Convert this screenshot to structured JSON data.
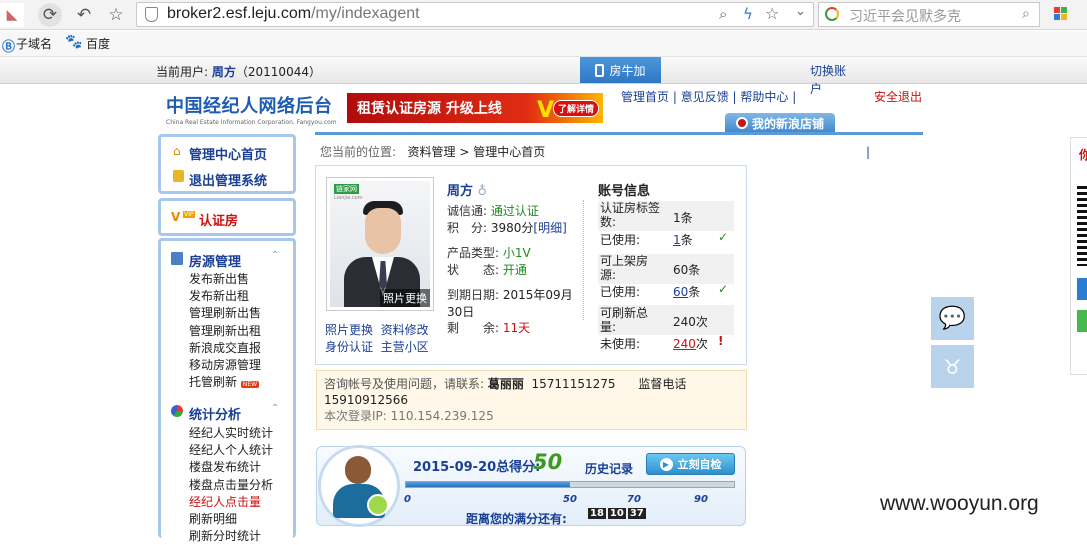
{
  "browser": {
    "url_host": "broker2.esf.leju.com",
    "url_path": "/my/indexagent",
    "search_placeholder": "习近平会见默多克",
    "bookmarks": [
      {
        "label": "子域名"
      },
      {
        "label": "百度"
      }
    ]
  },
  "topbar": {
    "current_user_label": "当前用户:",
    "user_name": "周方",
    "user_id": "（20110044）",
    "fangniu_button": "房牛加",
    "switch_account": "切换账户"
  },
  "header": {
    "logo_cn": "中国经纪人网络后台",
    "logo_en": "China Real Estate Information Corporation. Fangyou.com",
    "banner_text": "租赁认证房源 升级上线",
    "banner_link": "了解详情",
    "nav": [
      {
        "label": "管理首页"
      },
      {
        "label": "意见反馈"
      },
      {
        "label": "帮助中心"
      }
    ],
    "logout": "安全退出",
    "my_shop": "我的新浪店铺"
  },
  "sidebar": {
    "home": "管理中心首页",
    "exit": "退出管理系统",
    "vip": "认证房",
    "housing": {
      "title": "房源管理",
      "items": [
        "发布新出售",
        "发布新出租",
        "管理刷新出售",
        "管理刷新出租",
        "新浪成交直报",
        "移动房源管理",
        "托管刷新"
      ]
    },
    "stats": {
      "title": "统计分析",
      "items": [
        "经纪人实时统计",
        "经纪人个人统计",
        "楼盘发布统计",
        "楼盘点击量分析",
        "经纪人点击量",
        "刷新明细",
        "刷新分时统计"
      ]
    },
    "new_badge": "NEW"
  },
  "breadcrumb": {
    "prefix": "您当前的位置:",
    "section": "资料管理",
    "separator": ">",
    "page": "管理中心首页"
  },
  "profile": {
    "photo_change": "照片更换",
    "photo_watermark": "链家网",
    "photo_watermark_sub": "Lianjia.com",
    "links": [
      "照片更换",
      "资料修改",
      "身份认证",
      "主营小区"
    ],
    "name": "周方",
    "rows": [
      {
        "label": "诚信通:",
        "value": "通过认证"
      },
      {
        "label": "积　分:",
        "value": "3980分",
        "extra": "[明细]"
      },
      {
        "label": "产品类型:",
        "value": "小1V"
      },
      {
        "label": "状　　态:",
        "value": "开通"
      },
      {
        "label": "到期日期:",
        "value": "2015年09月30日"
      },
      {
        "label": "剩　　余:",
        "value": "11天"
      }
    ]
  },
  "account": {
    "title": "账号信息",
    "items": [
      {
        "label": "认证房标签数:",
        "value": "1条"
      },
      {
        "label": "已使用:",
        "value": "1",
        "unit": "条",
        "mark": "✓"
      },
      {
        "label": "可上架房源:",
        "value": "60条"
      },
      {
        "label": "已使用:",
        "value": "60",
        "unit": "条",
        "mark": "✓"
      },
      {
        "label": "可刷新总量:",
        "value": "240次"
      },
      {
        "label": "未使用:",
        "value": "240",
        "unit": "次",
        "mark": "!"
      }
    ]
  },
  "contact": {
    "line1": "咨询帐号及使用问题，请联系: ",
    "contact_name": "葛丽丽",
    "phone1": "15711151275",
    "supervise_label": "监督电话",
    "phone2": "15910912566",
    "login_ip_label": "本次登录IP: ",
    "login_ip": "110.154.239.125"
  },
  "score": {
    "date": "2015-09-20",
    "label": "总得分:",
    "value": "50",
    "progress": 0.5,
    "history": "历史记录",
    "check_button": "立刻自检",
    "ticks": [
      "0",
      "50",
      "70",
      "90"
    ],
    "full_label": "距离您的满分还有:",
    "countdown": [
      "18",
      "10",
      "37"
    ]
  },
  "right": {
    "partial_char": "你"
  },
  "watermark": "www.wooyun.org",
  "colors": {
    "accent": "#1a3f95",
    "frame": "#a7c8ea",
    "green": "#1e8a1e",
    "red": "#cc1111"
  }
}
